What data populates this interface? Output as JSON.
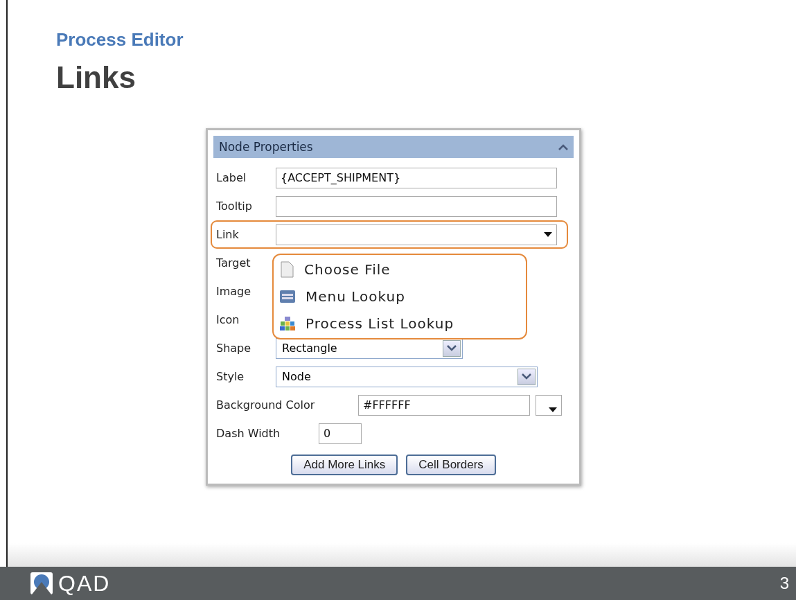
{
  "slide": {
    "section": "Process Editor",
    "title": "Links",
    "logo": "QAD",
    "page_number": "3"
  },
  "panel": {
    "title": "Node Properties",
    "expanded": true,
    "fields": [
      {
        "kind": "text",
        "label": "Label",
        "value": "{ACCEPT_SHIPMENT}",
        "highlighted": false
      },
      {
        "kind": "text",
        "label": "Tooltip",
        "highlighted": false
      },
      {
        "kind": "dropdown",
        "label": "Link",
        "highlighted": true
      },
      {
        "kind": "covered",
        "label": "Target",
        "highlighted": false
      },
      {
        "kind": "covered",
        "label": "Image",
        "highlighted": false
      },
      {
        "kind": "covered",
        "label": "Icon",
        "highlighted": false
      },
      {
        "kind": "select",
        "label": "Shape",
        "value": "Rectangle",
        "highlighted": false
      },
      {
        "kind": "select",
        "label": "Style",
        "value": "Node",
        "highlighted": false
      },
      {
        "kind": "color",
        "label": "Background Color",
        "value": "#FFFFFF",
        "highlighted": false
      },
      {
        "kind": "short",
        "label": "Dash Width",
        "value": "0",
        "highlighted": false
      }
    ],
    "buttons": [
      "Add More Links",
      "Cell Borders"
    ],
    "link_menu": {
      "highlighted": true,
      "items": [
        "Choose File",
        "Menu Lookup",
        "Process List Lookup"
      ]
    }
  }
}
